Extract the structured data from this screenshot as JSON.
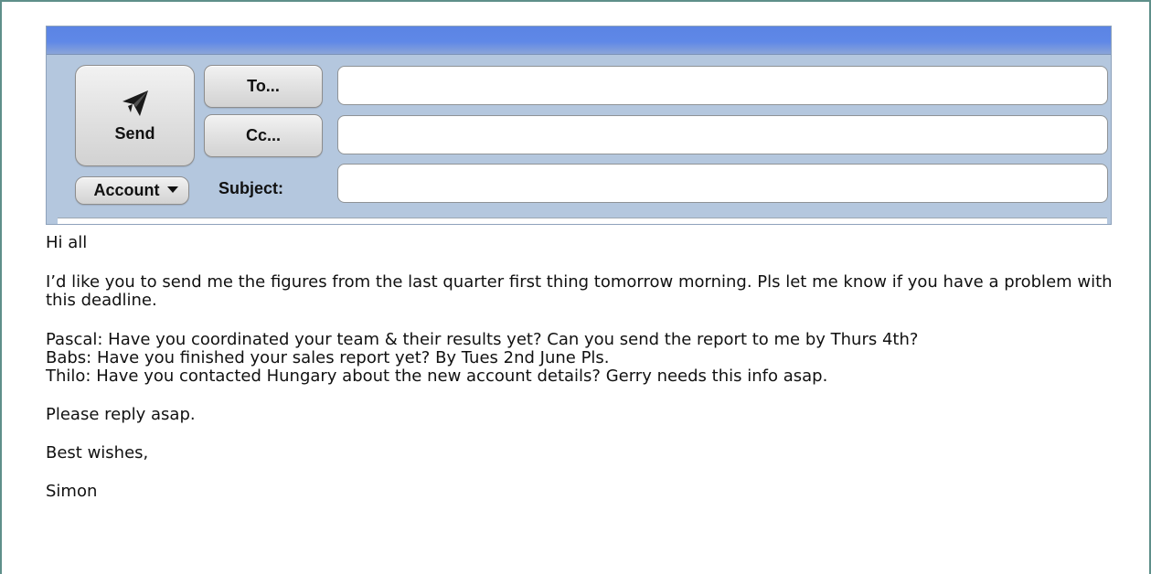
{
  "composer": {
    "send_label": "Send",
    "to_label": "To...",
    "cc_label": "Cc...",
    "account_label": "Account",
    "subject_label": "Subject:",
    "to_value": "",
    "cc_value": "",
    "subject_value": ""
  },
  "message": {
    "greeting": "Hi all",
    "paragraphs": [
      "I’d like you to send me the figures from the last quarter first thing tomorrow morning. Pls let me know if you have a problem with this deadline."
    ],
    "requests": [
      "Pascal: Have you coordinated your team & their results yet? Can you send the report to me by Thurs 4th?",
      "Babs: Have you finished your sales report yet? By Tues 2nd June Pls.",
      "Thilo: Have you contacted Hungary about the new account details? Gerry needs this info asap."
    ],
    "closing_lines": [
      "Please reply asap.",
      "Best wishes,",
      "Simon"
    ]
  },
  "icons": {
    "send": "paper-plane-icon",
    "dropdown": "chevron-down-icon"
  },
  "colors": {
    "frame_border": "#5f8f8a",
    "header_panel": "#b4c7de",
    "title_bar": "#5b84e4",
    "button_face": "#e2e2e2",
    "field_background": "#ffffff",
    "text": "#111111"
  }
}
